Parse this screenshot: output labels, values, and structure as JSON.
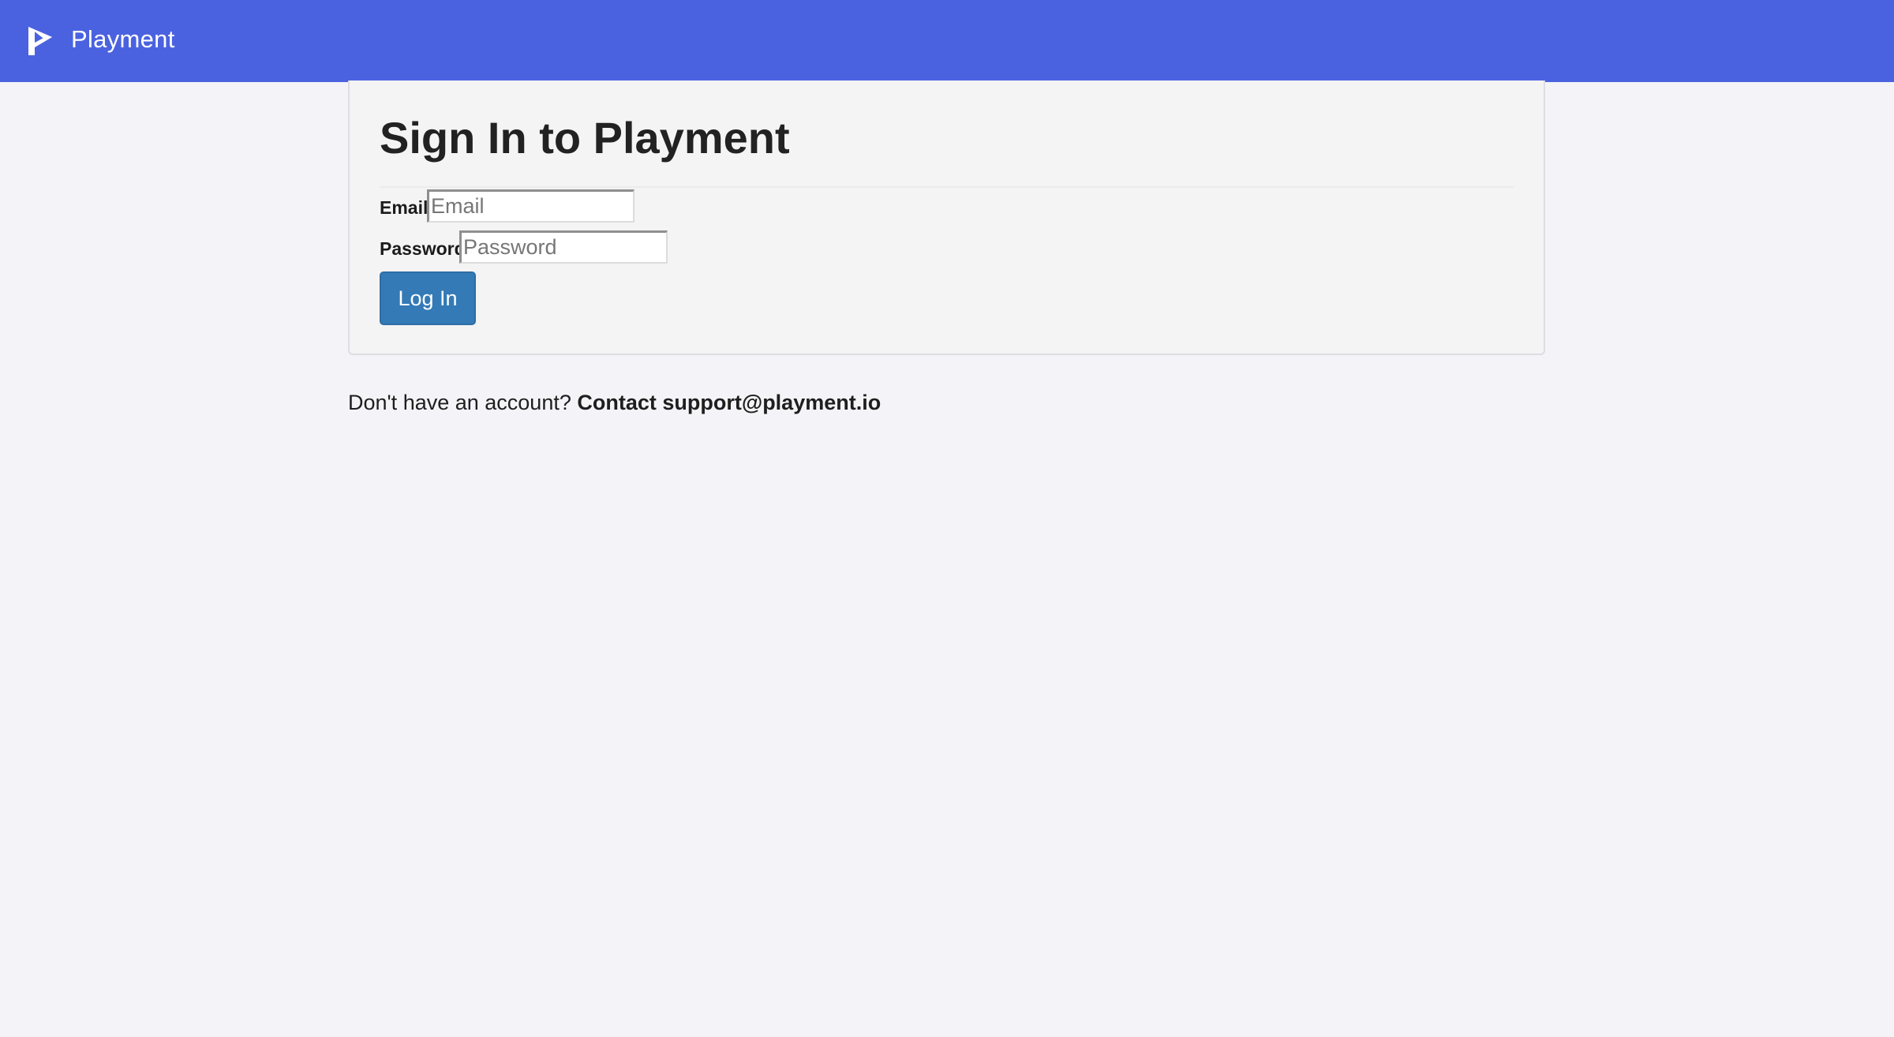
{
  "header": {
    "brand_name": "Playment",
    "logo_icon": "playment-logo-icon",
    "background_color": "#4b62e0"
  },
  "login": {
    "title": "Sign In to Playment",
    "email_label": "Email",
    "email_placeholder": "Email",
    "password_label": "Password",
    "password_placeholder": "Password",
    "submit_label": "Log In",
    "button_color": "#337ab7"
  },
  "footer": {
    "prompt": "Don't have an account?",
    "contact": "Contact support@playment.io"
  }
}
